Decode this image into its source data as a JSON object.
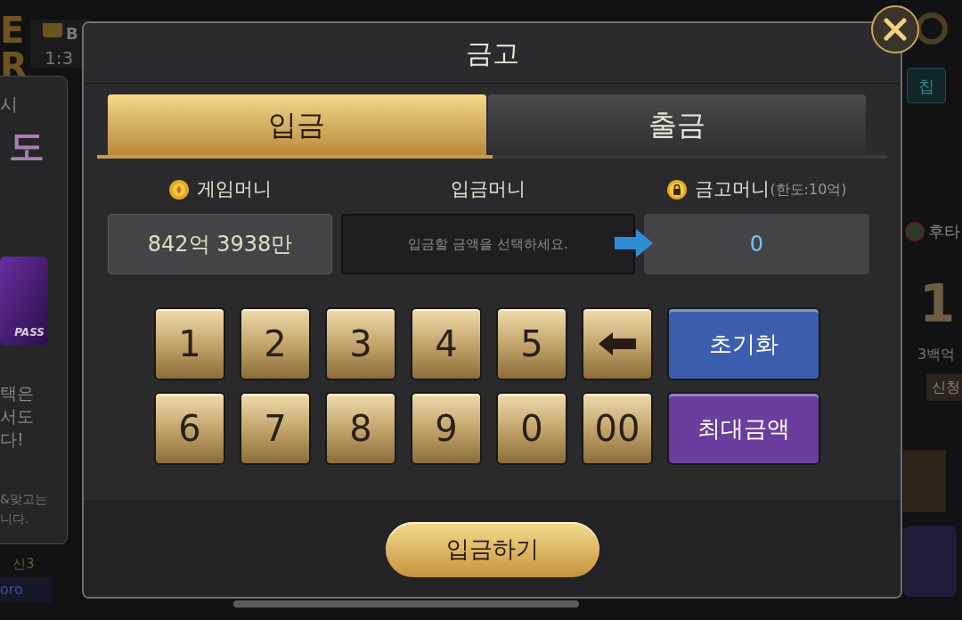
{
  "background": {
    "logo_letters": [
      "E",
      "R"
    ],
    "rank_label": "B",
    "score": "1:3",
    "promo_panel": {
      "top_line": "시",
      "headline": "도",
      "badge": "PASS",
      "body": [
        "택은",
        "서도",
        "다!"
      ],
      "footer": [
        "&맞고는",
        "니다."
      ]
    },
    "player_level": "신3",
    "player_name": "oro",
    "right": {
      "chip_button": "칩",
      "label": "후타",
      "big_number": "1",
      "amount": "3백억",
      "apply_button": "신청"
    }
  },
  "dialog": {
    "title": "금고",
    "tabs": [
      {
        "label": "입금",
        "selected": true
      },
      {
        "label": "출금",
        "selected": false
      }
    ],
    "columns": [
      {
        "kind": "coin",
        "label": "게임머니"
      },
      {
        "kind": "plain",
        "label": "입금머니"
      },
      {
        "kind": "lock",
        "label": "금고머니",
        "note": "(한도:10억)"
      }
    ],
    "game_money": "842억 3938만",
    "deposit_field": {
      "placeholder": "입금할 금액을 선택하세요."
    },
    "vault_money": "0",
    "keypad": [
      [
        {
          "kind": "digit",
          "label": "1"
        },
        {
          "kind": "digit",
          "label": "2"
        },
        {
          "kind": "digit",
          "label": "3"
        },
        {
          "kind": "digit",
          "label": "4"
        },
        {
          "kind": "digit",
          "label": "5"
        },
        {
          "kind": "backspace"
        },
        {
          "kind": "action",
          "label": "초기화",
          "color": "#3b5fae"
        }
      ],
      [
        {
          "kind": "digit",
          "label": "6"
        },
        {
          "kind": "digit",
          "label": "7"
        },
        {
          "kind": "digit",
          "label": "8"
        },
        {
          "kind": "digit",
          "label": "9"
        },
        {
          "kind": "digit",
          "label": "0"
        },
        {
          "kind": "digit",
          "label": "00"
        },
        {
          "kind": "action",
          "label": "최대금액",
          "color": "#6a3d9e"
        }
      ]
    ],
    "submit_button": "입금하기"
  }
}
